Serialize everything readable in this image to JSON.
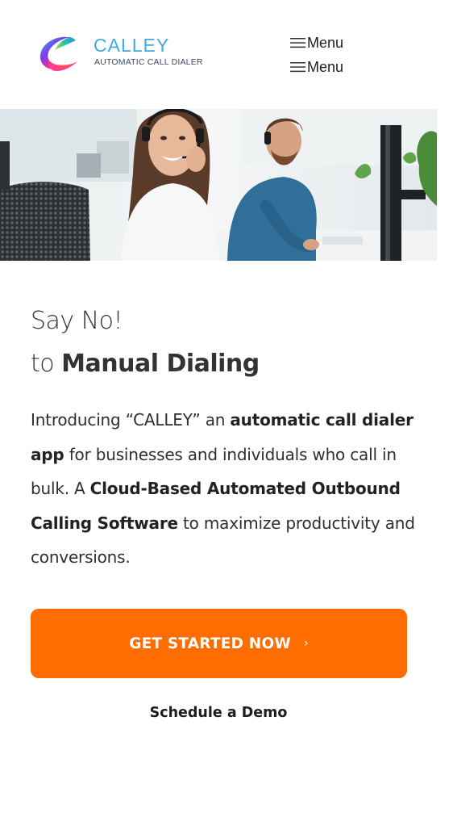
{
  "header": {
    "logo": {
      "name": "CALLEY",
      "tagline": "AUTOMATIC CALL DIALER"
    },
    "menu_items": [
      {
        "label": "Menu",
        "icon": "hamburger-icon"
      },
      {
        "label": "Menu",
        "icon": "hamburger-icon"
      }
    ]
  },
  "hero": {
    "image": "call-center-agents-with-headsets-photo"
  },
  "main": {
    "headline_line1": "Say No!",
    "headline_line2_prefix": "to ",
    "headline_line2_strong": "Manual Dialing",
    "intro": {
      "t1": "Introducing “CALLEY” an ",
      "b1": "automatic call dialer app",
      "t2": " for businesses and individuals who call in bulk. A ",
      "b2": "Cloud-Based Automated Outbound Calling Software",
      "t3": " to maximize productivity and conversions."
    },
    "cta_label": "GET STARTED NOW",
    "cta_icon": "chevron-right-icon",
    "demo_label": "Schedule a Demo"
  },
  "colors": {
    "accent": "#ff6d00",
    "logo_blue": "#45a9dd",
    "text": "#2f2f2f"
  }
}
